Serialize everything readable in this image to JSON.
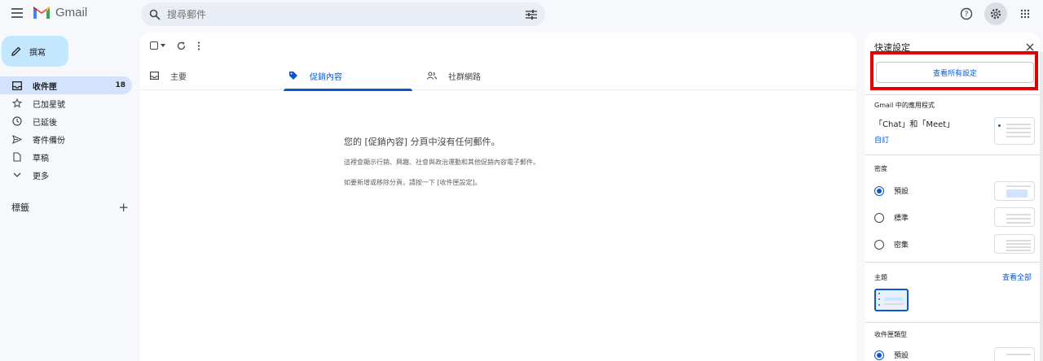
{
  "app": {
    "name": "Gmail"
  },
  "search": {
    "placeholder": "搜尋郵件"
  },
  "sidebar": {
    "compose_label": "撰寫",
    "items": [
      {
        "label": "收件匣",
        "count": "18",
        "icon": "inbox-icon",
        "active": true
      },
      {
        "label": "已加星號",
        "icon": "star-icon"
      },
      {
        "label": "已延後",
        "icon": "clock-icon"
      },
      {
        "label": "寄件備份",
        "icon": "send-icon"
      },
      {
        "label": "草稿",
        "icon": "draft-icon"
      },
      {
        "label": "更多",
        "icon": "chevron-down-icon"
      }
    ],
    "labels_heading": "標籤"
  },
  "tabs": [
    {
      "label": "主要",
      "icon": "inbox-icon"
    },
    {
      "label": "促銷內容",
      "icon": "tag-icon",
      "active": true
    },
    {
      "label": "社群網路",
      "icon": "people-icon"
    }
  ],
  "empty_state": {
    "heading": "您的 [促銷內容] 分頁中沒有任何郵件。",
    "line1": "這裡會顯示行銷、興趣、社會與政治運動和其他促銷內容電子郵件。",
    "line2": "如要新增或移除分頁，請按一下 [收件匣設定]。"
  },
  "quick_settings": {
    "title": "快速設定",
    "see_all_settings": "查看所有設定",
    "apps_heading": "Gmail 中的應用程式",
    "apps_value": "「Chat」和「Meet」",
    "apps_customize": "自訂",
    "density_heading": "密度",
    "density_options": [
      "預設",
      "標準",
      "密集"
    ],
    "theme_heading": "主題",
    "theme_view_all": "查看全部",
    "inbox_type_heading": "收件匣類型",
    "inbox_type_first": "預設"
  },
  "colors": {
    "accent": "#0b57d0",
    "highlight": "#e10000",
    "compose_bg": "#c2e7ff"
  }
}
